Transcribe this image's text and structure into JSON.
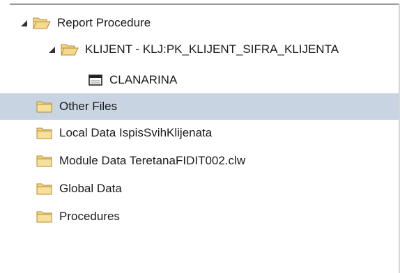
{
  "tree": {
    "report_procedure": {
      "label": "Report Procedure",
      "icon": "open-folder-icon",
      "expanded": true
    },
    "klijent": {
      "label": "KLIJENT - KLJ:PK_KLIJENT_SIFRA_KLIJENTA",
      "icon": "open-folder-icon",
      "expanded": true
    },
    "clanarina": {
      "label": "CLANARINA",
      "icon": "table-icon"
    },
    "other_files": {
      "label": "Other Files",
      "icon": "folder-icon",
      "selected": true
    },
    "local_data": {
      "label": "Local Data IspisSvihKlijenata",
      "icon": "folder-icon"
    },
    "module_data": {
      "label": "Module Data TeretanaFIDIT002.clw",
      "icon": "folder-icon"
    },
    "global_data": {
      "label": "Global Data",
      "icon": "folder-icon"
    },
    "procedures": {
      "label": "Procedures",
      "icon": "folder-icon"
    }
  },
  "colors": {
    "selection": "#c9d4e2",
    "folder_fill": "#f3d58a",
    "folder_stroke": "#b58a35",
    "expander": "#333333"
  }
}
